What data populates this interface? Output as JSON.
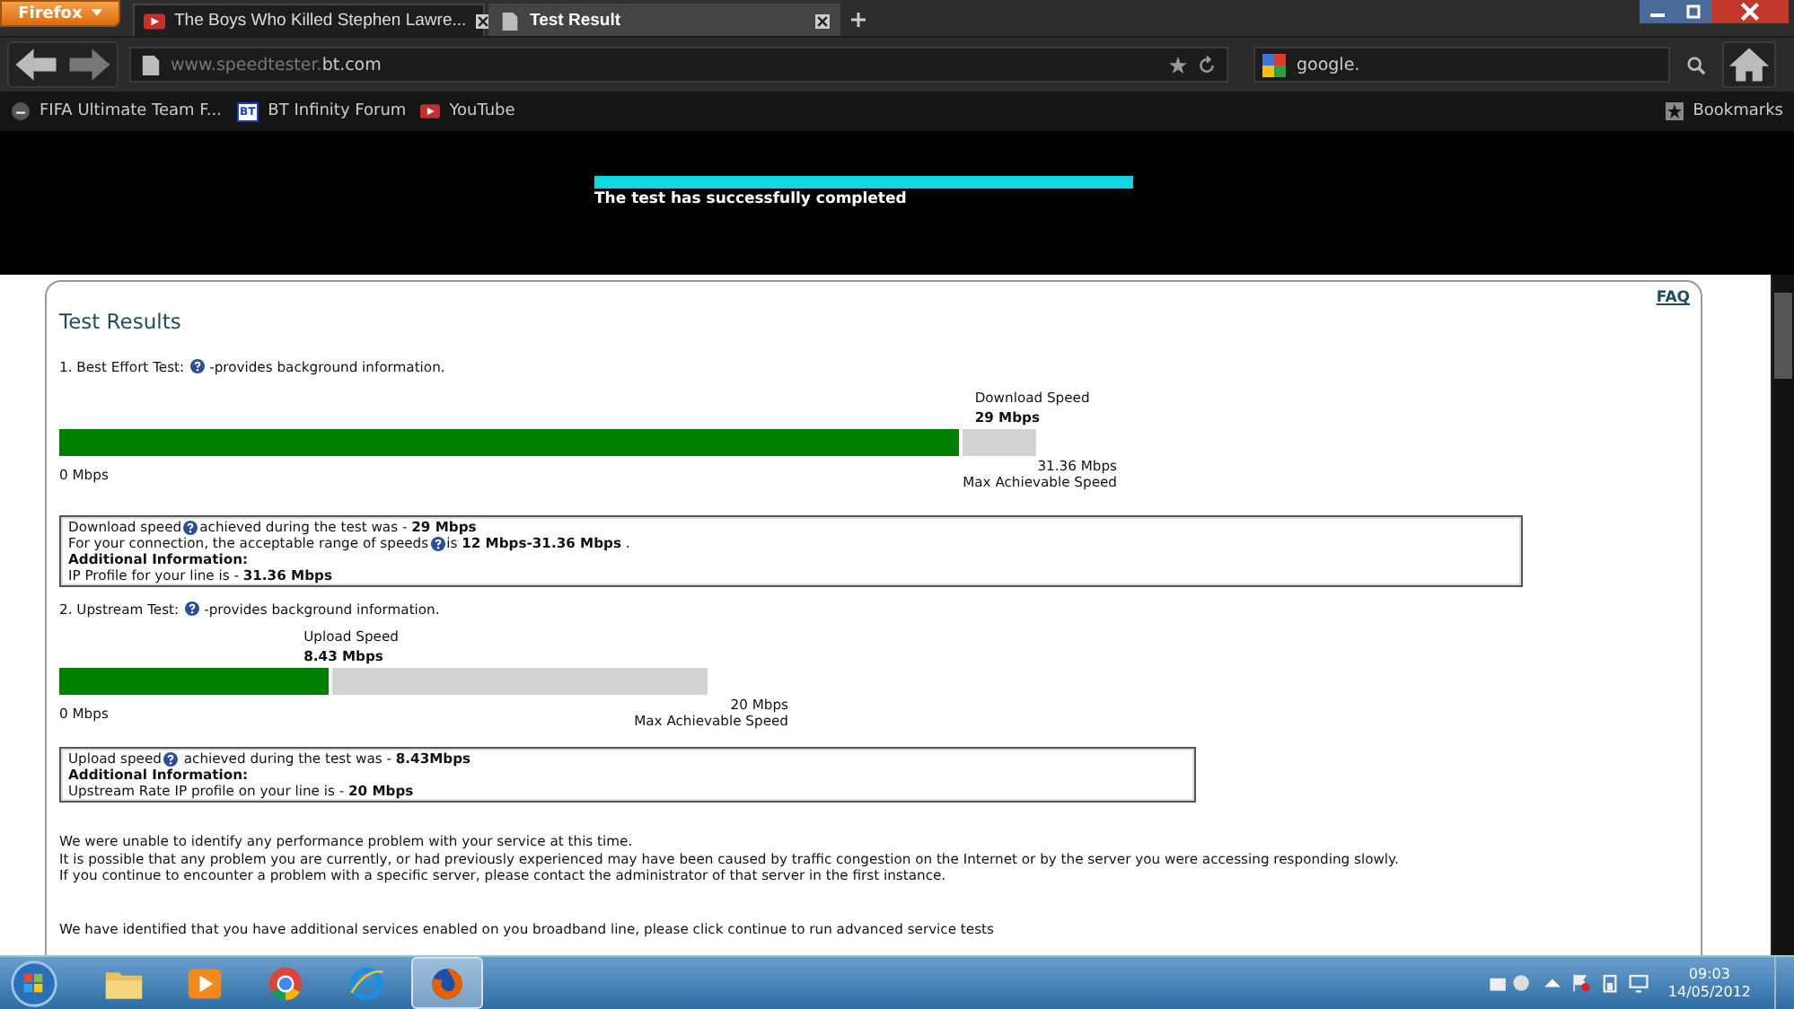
{
  "browser": {
    "menu_button": "Firefox",
    "tabs": [
      {
        "title": "The Boys Who Killed Stephen Lawre...",
        "selected": false,
        "kind": "video"
      },
      {
        "title": "Test Result",
        "selected": true,
        "kind": "page"
      }
    ],
    "address": {
      "host_prefix": "www.speedtester.",
      "domain": "bt.com"
    },
    "search": {
      "value": "google."
    },
    "bookmarks": [
      {
        "label": "FIFA Ultimate Team F...",
        "kind": "ea"
      },
      {
        "label": "BT Infinity Forum",
        "kind": "bt",
        "icon_text": "BT"
      },
      {
        "label": "YouTube",
        "kind": "video"
      }
    ],
    "bookmarks_menu": "Bookmarks"
  },
  "banner": {
    "level": 1,
    "message": "The test has successfully completed"
  },
  "page": {
    "title": "Test Results",
    "faq": "FAQ",
    "tests": [
      {
        "heading": "1. Best Effort Test:",
        "note": "-provides background information.",
        "meter_title": "Download Speed",
        "reading": "29 Mbps",
        "level": 0.925,
        "min": "0 Mbps",
        "max": "31.36 Mbps",
        "max_caption": "Max Achievable Speed",
        "info": [
          {
            "lead": "Download speed",
            "help": true,
            "text": "achieved during the test was - **29 Mbps**"
          },
          {
            "lead": "For your connection, the acceptable range of speeds",
            "help": true,
            "text": "is **12 Mbps-31.36 Mbps** ."
          },
          {
            "kind": "heading",
            "text": "Additional Information:"
          },
          {
            "text": "IP Profile for your line is - **31.36 Mbps**"
          }
        ]
      },
      {
        "heading": "2. Upstream Test:",
        "note": "-provides background information.",
        "meter_title": "Upload Speed",
        "reading": "8.43 Mbps",
        "level": 0.4215,
        "min": "0 Mbps",
        "max": "20 Mbps",
        "max_caption": "Max Achievable Speed",
        "info": [
          {
            "lead": "Upload speed",
            "help": true,
            "text": " achieved during the test was - **8.43Mbps**"
          },
          {
            "kind": "heading",
            "text": "Additional Information:"
          },
          {
            "text": "Upstream Rate IP profile on your line is - **20 Mbps**"
          }
        ]
      }
    ],
    "messages": [
      "We were unable to identify any performance problem with your service at this time.",
      "It is possible that any problem you are currently, or had previously experienced may have been caused by traffic congestion on the Internet or by the server you were accessing responding slowly.",
      "If you continue to encounter a problem with a specific server, please contact the administrator of that server in the first instance."
    ],
    "footer_message": "We have identified that you have additional services enabled on you broadband line, please click continue to run advanced service tests"
  },
  "taskbar": {
    "apps": [
      {
        "kind": "folder",
        "selected": false
      },
      {
        "kind": "media",
        "selected": false
      },
      {
        "kind": "chrome",
        "selected": false
      },
      {
        "kind": "ie",
        "selected": false
      },
      {
        "kind": "firefox",
        "selected": true
      }
    ],
    "time": "09:03",
    "date": "14/05/2012"
  }
}
